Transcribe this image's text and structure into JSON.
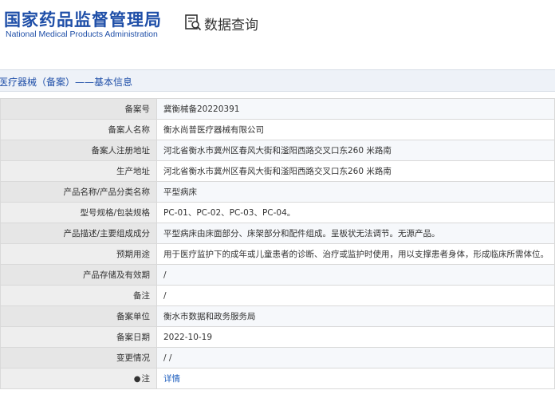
{
  "header": {
    "logo_cn": "国家药品监督管理局",
    "logo_en": "National Medical Products Administration",
    "query_title": "数据查询"
  },
  "section": {
    "title": "医疗器械（备案）——基本信息"
  },
  "rows": [
    {
      "label": "备案号",
      "value": "冀衡械备20220391"
    },
    {
      "label": "备案人名称",
      "value": "衡水尚普医疗器械有限公司"
    },
    {
      "label": "备案人注册地址",
      "value": "河北省衡水市冀州区春风大街和滏阳西路交叉口东260 米路南"
    },
    {
      "label": "生产地址",
      "value": "河北省衡水市冀州区春风大街和滏阳西路交叉口东260 米路南"
    },
    {
      "label": "产品名称/产品分类名称",
      "value": "平型病床"
    },
    {
      "label": "型号规格/包装规格",
      "value": "PC-01、PC-02、PC-03、PC-04。"
    },
    {
      "label": "产品描述/主要组成成分",
      "value": "平型病床由床面部分、床架部分和配件组成。呈板状无法调节。无源产品。"
    },
    {
      "label": "预期用途",
      "value": "用于医疗监护下的成年或儿童患者的诊断、治疗或监护时使用，用以支撑患者身体，形成临床所需体位。"
    },
    {
      "label": "产品存储及有效期",
      "value": "/"
    },
    {
      "label": "备注",
      "value": "/"
    },
    {
      "label": "备案单位",
      "value": "衡水市数据和政务服务局"
    },
    {
      "label": "备案日期",
      "value": "2022-10-19"
    },
    {
      "label": "变更情况",
      "value": "/ /"
    },
    {
      "label": "注",
      "value": "详情"
    }
  ]
}
